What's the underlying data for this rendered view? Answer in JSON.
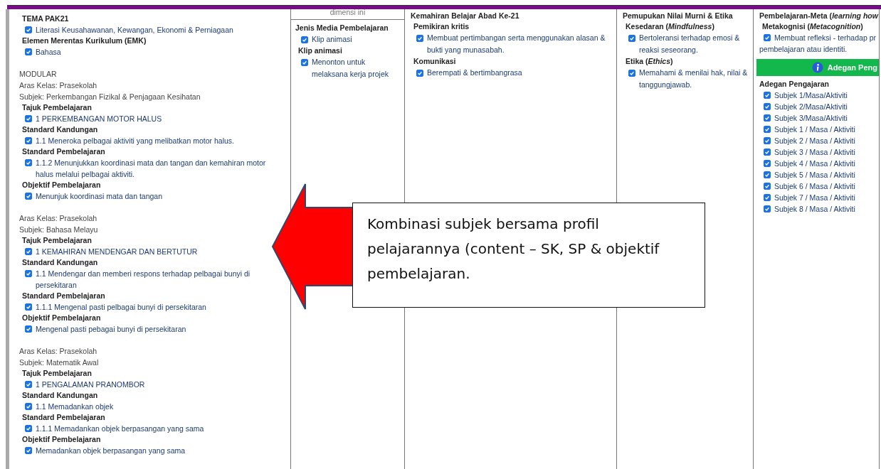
{
  "columns": [
    {
      "kind": "hanging",
      "groups": [
        [
          {
            "kind": "heading",
            "text": "TEMA PAK21"
          },
          {
            "kind": "check",
            "text": "Literasi Keusahawanan, Kewangan, Ekonomi & Perniagaan",
            "checked": true
          },
          {
            "kind": "heading",
            "text": "Elemen Merentas Kurikulum (EMK)"
          },
          {
            "kind": "check",
            "text": "Bahasa",
            "checked": true
          }
        ],
        [
          {
            "kind": "text",
            "text": "MODULAR"
          },
          {
            "kind": "text",
            "text": "Aras Kelas: Prasekolah"
          },
          {
            "kind": "text",
            "text": "Subjek: Perkembangan Fizikal & Penjagaan Kesihatan"
          },
          {
            "kind": "heading",
            "text": "Tajuk Pembelajaran"
          },
          {
            "kind": "check",
            "text": "1 PERKEMBANGAN MOTOR HALUS",
            "checked": true
          },
          {
            "kind": "heading",
            "text": "Standard Kandungan"
          },
          {
            "kind": "check",
            "text": "1.1 Meneroka pelbagai aktiviti yang melibatkan motor halus.",
            "checked": true
          },
          {
            "kind": "heading",
            "text": "Standard Pembelajaran"
          },
          {
            "kind": "check",
            "text": "1.1.2 Menunjukkan koordinasi mata dan tangan dan kemahiran motor halus melalui pelbagai aktiviti.",
            "checked": true
          },
          {
            "kind": "heading",
            "text": "Objektif Pembelajaran"
          },
          {
            "kind": "check",
            "text": "Menunjuk koordinasi mata dan tangan",
            "checked": true
          }
        ],
        [
          {
            "kind": "text",
            "text": "Aras Kelas: Prasekolah"
          },
          {
            "kind": "text",
            "text": "Subjek: Bahasa Melayu"
          },
          {
            "kind": "heading",
            "text": "Tajuk Pembelajaran"
          },
          {
            "kind": "check",
            "text": "1 KEMAHIRAN MENDENGAR DAN BERTUTUR",
            "checked": true
          },
          {
            "kind": "heading",
            "text": "Standard Kandungan"
          },
          {
            "kind": "check",
            "text": "1.1 Mendengar dan memberi respons terhadap pelbagai bunyi di persekitaran",
            "checked": true
          },
          {
            "kind": "heading",
            "text": "Standard Pembelajaran"
          },
          {
            "kind": "check",
            "text": "1.1.1 Mengenal pasti pelbagai bunyi di persekitaran",
            "checked": true
          },
          {
            "kind": "heading",
            "text": "Objektif Pembelajaran"
          },
          {
            "kind": "check",
            "text": "Mengenal pasti pebagai bunyi di persekitaran",
            "checked": true
          }
        ],
        [
          {
            "kind": "text",
            "text": "Aras Kelas: Prasekolah"
          },
          {
            "kind": "text",
            "text": "Subjek: Matematik Awal"
          },
          {
            "kind": "heading",
            "text": "Tajuk Pembelajaran"
          },
          {
            "kind": "check",
            "text": "1 PENGALAMAN PRANOMBOR",
            "checked": true
          },
          {
            "kind": "heading",
            "text": "Standard Kandungan"
          },
          {
            "kind": "check",
            "text": "1.1 Memadankan objek",
            "checked": true
          },
          {
            "kind": "heading",
            "text": "Standard Pembelajaran"
          },
          {
            "kind": "check",
            "text": "1.1.1 Memadankan objek berpasangan yang sama",
            "checked": true
          },
          {
            "kind": "heading",
            "text": "Objektif Pembelajaran"
          },
          {
            "kind": "check",
            "text": "Memadankan objek berpasangan yang sama",
            "checked": true
          }
        ]
      ]
    },
    {
      "kind": "flow",
      "note": "dimensi ini",
      "groups": [
        [
          {
            "kind": "title",
            "text": "Jenis Media Pembelajaran"
          },
          {
            "kind": "check",
            "text": "Klip animasi",
            "checked": true
          },
          {
            "kind": "heading",
            "text": "Klip animasi"
          },
          {
            "kind": "check",
            "text": "Menonton untuk melaksana kerja projek",
            "checked": true
          }
        ]
      ]
    },
    {
      "kind": "flow",
      "groups": [
        [
          {
            "kind": "title",
            "text": "Kemahiran Belajar Abad Ke-21"
          },
          {
            "kind": "heading",
            "text": "Pemikiran kritis"
          },
          {
            "kind": "check",
            "text": "Membuat pertimbangan serta menggunakan alasan & bukti yang munasabah.",
            "checked": true
          },
          {
            "kind": "heading",
            "text": "Komunikasi"
          },
          {
            "kind": "check",
            "text": "Berempati & bertimbangrasa",
            "checked": true
          }
        ]
      ]
    },
    {
      "kind": "flow",
      "groups": [
        [
          {
            "kind": "title",
            "text": "Pemupukan Nilai Murni & Etika"
          },
          {
            "kind": "heading",
            "text": "Kesedaran (*Mindfulness*)"
          },
          {
            "kind": "check",
            "text": "Bertoleransi terhadap emosi & reaksi seseorang.",
            "checked": true
          },
          {
            "kind": "heading",
            "text": "Etika (*Ethics*)"
          },
          {
            "kind": "check",
            "text": "Memahami & menilai hak, nilai & tanggungjawab.",
            "checked": true
          }
        ]
      ]
    },
    {
      "kind": "cut",
      "groups": [
        [
          {
            "kind": "title",
            "text": "Pembelajaran-Meta (*learning how*"
          },
          {
            "kind": "heading",
            "text": "Metakognisi (*Metacognition*)"
          },
          {
            "kind": "check",
            "text": "Membuat refleksi - terhadap pr",
            "checked": true
          },
          {
            "kind": "text",
            "text": "pembelajaran atau identiti."
          },
          {
            "kind": "banner",
            "text": "Adegan Peng"
          },
          {
            "kind": "title",
            "text": "Adegan Pengajaran"
          },
          {
            "kind": "check",
            "text": "Subjek 1/Masa/Aktiviti",
            "checked": true
          },
          {
            "kind": "check",
            "text": "Subjek 2/Masa/Aktiviti",
            "checked": true
          },
          {
            "kind": "check",
            "text": "Subjek 3/Masa/Aktiviti",
            "checked": true
          },
          {
            "kind": "check",
            "text": "Subjek 1 / Masa / Aktiviti",
            "checked": true
          },
          {
            "kind": "check",
            "text": "Subjek 2 / Masa / Aktiviti",
            "checked": true
          },
          {
            "kind": "check",
            "text": "Subjek 3 / Masa / Aktiviti",
            "checked": true
          },
          {
            "kind": "check",
            "text": "Subjek 4 / Masa / Aktiviti",
            "checked": true
          },
          {
            "kind": "check",
            "text": "Subjek 5 / Masa / Aktiviti",
            "checked": true
          },
          {
            "kind": "check",
            "text": "Subjek 6 / Masa / Aktiviti",
            "checked": true
          },
          {
            "kind": "check",
            "text": "Subjek 7 / Masa / Aktiviti",
            "checked": true
          },
          {
            "kind": "check",
            "text": "Subjek 8 / Masa / Aktiviti",
            "checked": true
          }
        ]
      ]
    }
  ],
  "callout": {
    "text": "Kombinasi subjek bersama profil pelajarannya (content – SK, SP & objektif pembelajaran."
  }
}
